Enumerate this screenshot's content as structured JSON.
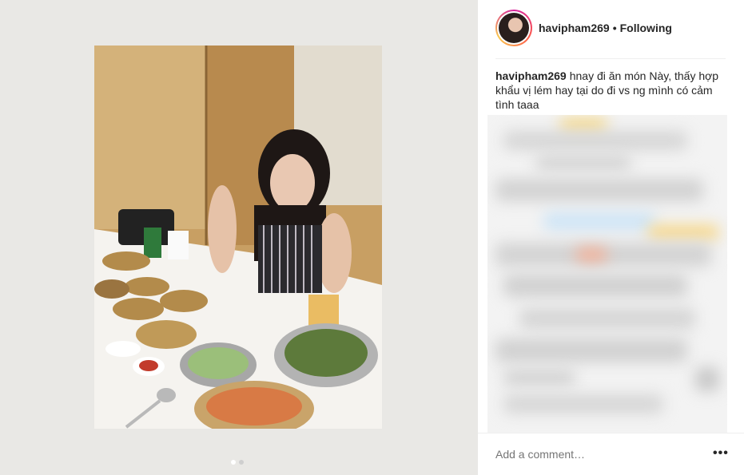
{
  "post": {
    "username": "havipham269",
    "separator": "•",
    "follow_status": "Following",
    "caption_user": "havipham269",
    "caption_text": "hnay đi ăn món Này, thấy hợp khẩu vị lém hay tại do đi vs ng mình có cảm tình taaa"
  },
  "comment": {
    "placeholder": "Add a comment…",
    "more_label": "•••"
  },
  "carousel": {
    "slide_count": 2,
    "current_slide": 1
  }
}
